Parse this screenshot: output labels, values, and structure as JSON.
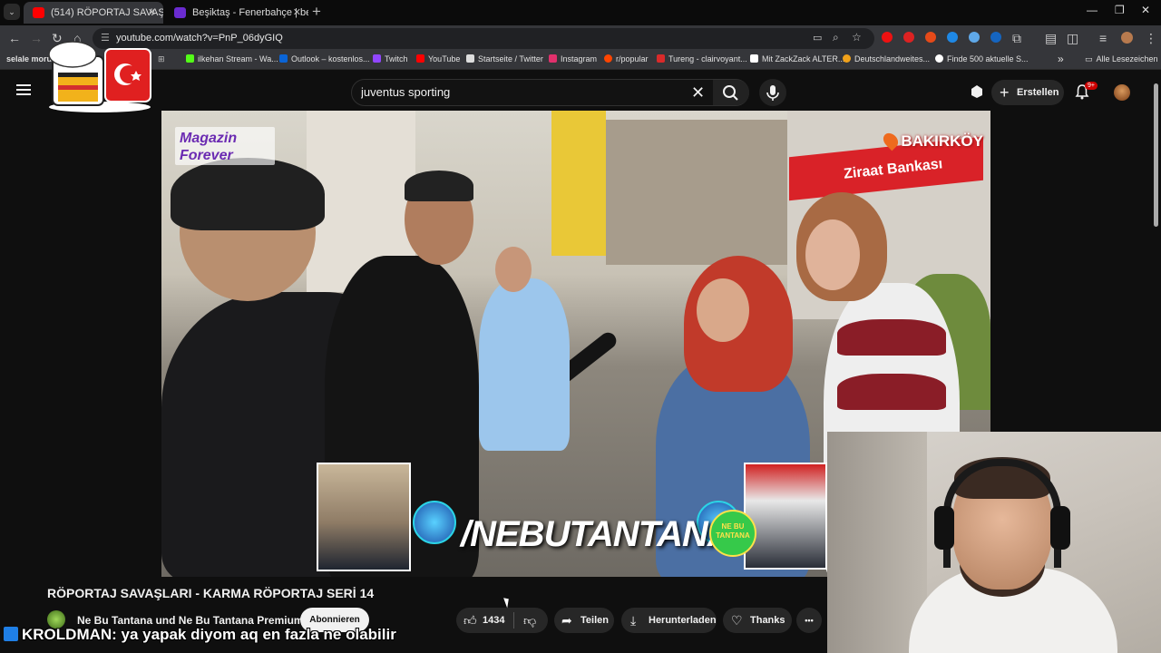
{
  "browser": {
    "tabs": [
      {
        "title": "(514) RÖPORTAJ SAVAŞLARI - K",
        "active": true
      },
      {
        "title": "Beşiktaş - Fenerbahçe | beIN SP",
        "active": false
      }
    ],
    "new_tab_label": "+",
    "url": "youtube.com/watch?v=PnP_06dyGIQ",
    "bookmarks": [
      {
        "label": "selale moruk"
      },
      {
        "label": "ilkehan Stream - Wa...",
        "color": "#53fc18"
      },
      {
        "label": "Outlook – kostenlos...",
        "color": "#0a64d6"
      },
      {
        "label": "Twitch",
        "color": "#9146ff"
      },
      {
        "label": "YouTube",
        "color": "#ff0000"
      },
      {
        "label": "Startseite / Twitter",
        "color": "#ffffff"
      },
      {
        "label": "Instagram",
        "color": "#e1306c"
      },
      {
        "label": "r/popular",
        "color": "#ff4500"
      },
      {
        "label": "Tureng - clairvoyant...",
        "color": "#d92a2a"
      },
      {
        "label": "Mit ZackZack ALTER...",
        "color": "#ffffff"
      },
      {
        "label": "Deutschlandweites...",
        "color": "#f0a11a"
      },
      {
        "label": "Finde 500 aktuelle S...",
        "color": "#ffffff"
      }
    ],
    "bookmarks_overflow": "»",
    "all_bookmarks": "Alle Lesezeichen"
  },
  "youtube": {
    "search_value": "juventus sporting",
    "create_label": "Erstellen",
    "notification_badge": "9+",
    "video": {
      "watermark": "Magazin Forever",
      "location_tag": "BAKIRKÖY",
      "bank_sign": "Ziraat Bankası",
      "channel_overlay": "/NEBUTANTANA",
      "logo_text": "NE BU TANTANA"
    },
    "title": "RÖPORTAJ SAVAŞLARI - KARMA RÖPORTAJ SERİ 14",
    "channel_name": "Ne Bu Tantana und Ne Bu Tantana Premium",
    "subscribe_label": "Abonnieren",
    "like_count": "1434",
    "share_label": "Teilen",
    "download_label": "Herunterladen",
    "thanks_label": "Thanks",
    "more_label": "•••"
  },
  "chat": {
    "user": "KROLDMAN",
    "message": ": ya yapak diyom aq en fazla ne olabilir"
  },
  "colors": {
    "accent_red": "#ff0000",
    "badge_red": "#cc0000",
    "bg": "#0f0f0f"
  }
}
